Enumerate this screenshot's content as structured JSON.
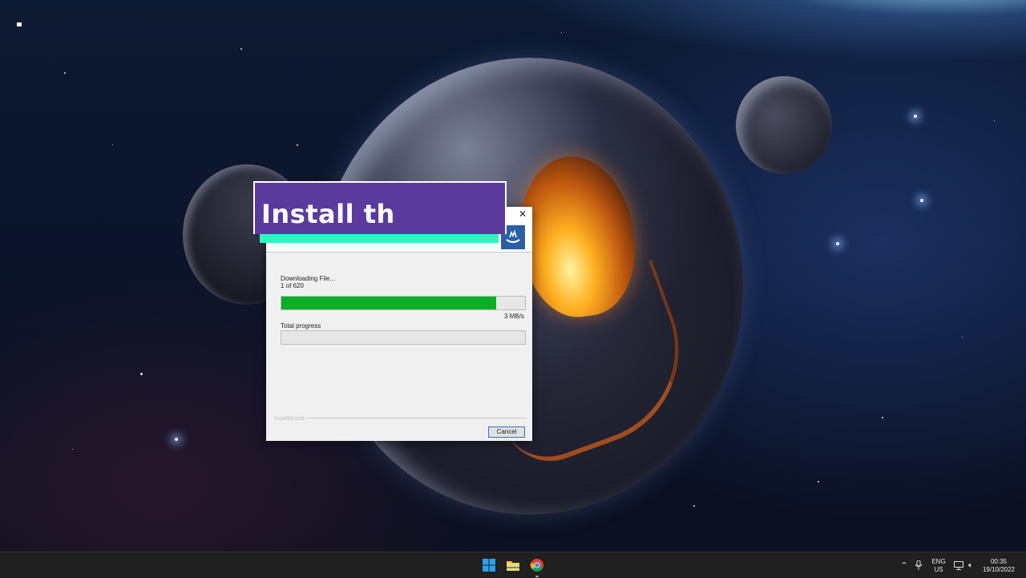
{
  "banner": {
    "title": "Install th"
  },
  "dialog": {
    "close_glyph": "✕",
    "status": "Downloading File...",
    "file_count": "1 of 620",
    "file_progress": 0.88,
    "speed": "3 MB/s",
    "total_label": "Total progress",
    "total_progress": 0.0,
    "brand": "InstallShield",
    "cancel_label": "Cancel"
  },
  "taskbar": {
    "icons": [
      "windows-start-icon",
      "file-explorer-icon",
      "chrome-icon"
    ],
    "tray": {
      "language": "ENG",
      "region": "US",
      "time": "00:35",
      "date": "19/10/2022"
    }
  },
  "colors": {
    "banner_bg": "#5b3a9e",
    "banner_accent": "#2ef5c4",
    "progress_green": "#06b025",
    "cancel_border": "#2c6fd1"
  }
}
